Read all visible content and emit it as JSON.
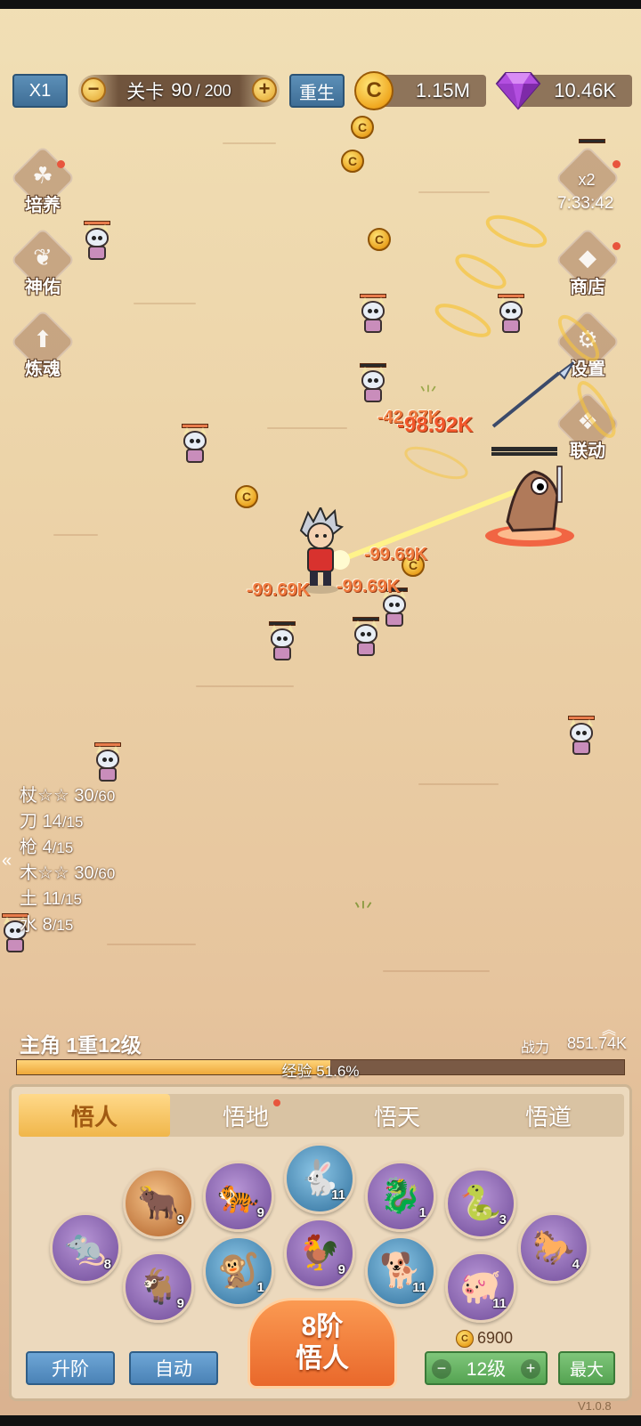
{
  "hud": {
    "speed_label": "X1",
    "stage_label": "关卡",
    "stage_current": "90",
    "stage_total": "/ 200",
    "rebirth_label": "重生",
    "coins": "1.15M",
    "gems": "10.46K",
    "coin_symbol": "C"
  },
  "left_menu": [
    {
      "label": "培养",
      "glyph": "☘"
    },
    {
      "label": "神佑",
      "glyph": "❦"
    },
    {
      "label": "炼魂",
      "glyph": "⬆"
    }
  ],
  "right_menu": {
    "boost_label": "x2",
    "timer": "7:33:42",
    "items": [
      {
        "label": "商店",
        "glyph": "◆"
      },
      {
        "label": "设置",
        "glyph": "⚙"
      },
      {
        "label": "联动",
        "glyph": "❖"
      }
    ]
  },
  "battle": {
    "damage_numbers": [
      "-42.97K",
      "-98.92K",
      "-99.69K",
      "-99.69K",
      "-99.69K"
    ]
  },
  "weapon_counts": [
    {
      "name": "杖☆☆",
      "current": "30",
      "max": "/60"
    },
    {
      "name": "刀",
      "current": "14",
      "max": "/15"
    },
    {
      "name": "枪",
      "current": "4",
      "max": "/15"
    },
    {
      "name": "木☆☆",
      "current": "30",
      "max": "/60"
    },
    {
      "name": "土",
      "current": "11",
      "max": "/15"
    },
    {
      "name": "水",
      "current": "8",
      "max": "/15"
    }
  ],
  "hero": {
    "title": "主角 1重12级",
    "power_label": "战力",
    "power_value": "851.74K",
    "exp_label": "经验 51.6%",
    "exp_fraction": 0.516
  },
  "tabs": [
    "悟人",
    "悟地",
    "悟天",
    "悟道"
  ],
  "zodiac": [
    {
      "name": "rat",
      "glyph": "🐀",
      "level": "8",
      "color": "purple"
    },
    {
      "name": "ox",
      "glyph": "🐂",
      "level": "9",
      "color": "orange"
    },
    {
      "name": "tiger",
      "glyph": "🐅",
      "level": "9",
      "color": "purple"
    },
    {
      "name": "rabbit",
      "glyph": "🐇",
      "level": "11",
      "color": "blue"
    },
    {
      "name": "dragon",
      "glyph": "🐉",
      "level": "1",
      "color": "purple"
    },
    {
      "name": "snake",
      "glyph": "🐍",
      "level": "3",
      "color": "purple"
    },
    {
      "name": "horse",
      "glyph": "🐎",
      "level": "4",
      "color": "purple"
    },
    {
      "name": "goat",
      "glyph": "🐐",
      "level": "9",
      "color": "purple"
    },
    {
      "name": "monkey",
      "glyph": "🐒",
      "level": "1",
      "color": "blue"
    },
    {
      "name": "rooster",
      "glyph": "🐓",
      "level": "9",
      "color": "purple"
    },
    {
      "name": "dog",
      "glyph": "🐕",
      "level": "11",
      "color": "blue"
    },
    {
      "name": "pig",
      "glyph": "🐖",
      "level": "11",
      "color": "purple"
    }
  ],
  "actions": {
    "upgrade_tier": "升阶",
    "auto": "自动",
    "main_line1": "8阶",
    "main_line2": "悟人",
    "cost": "6900",
    "level": "12级",
    "max": "最大"
  },
  "version": "V1.0.8",
  "colors": {
    "sand": "#ecd3a8",
    "panel": "#ecd9bd",
    "accent_orange": "#e9682b",
    "hud_blue": "#4a82b6",
    "damage": "#f07a3e"
  }
}
